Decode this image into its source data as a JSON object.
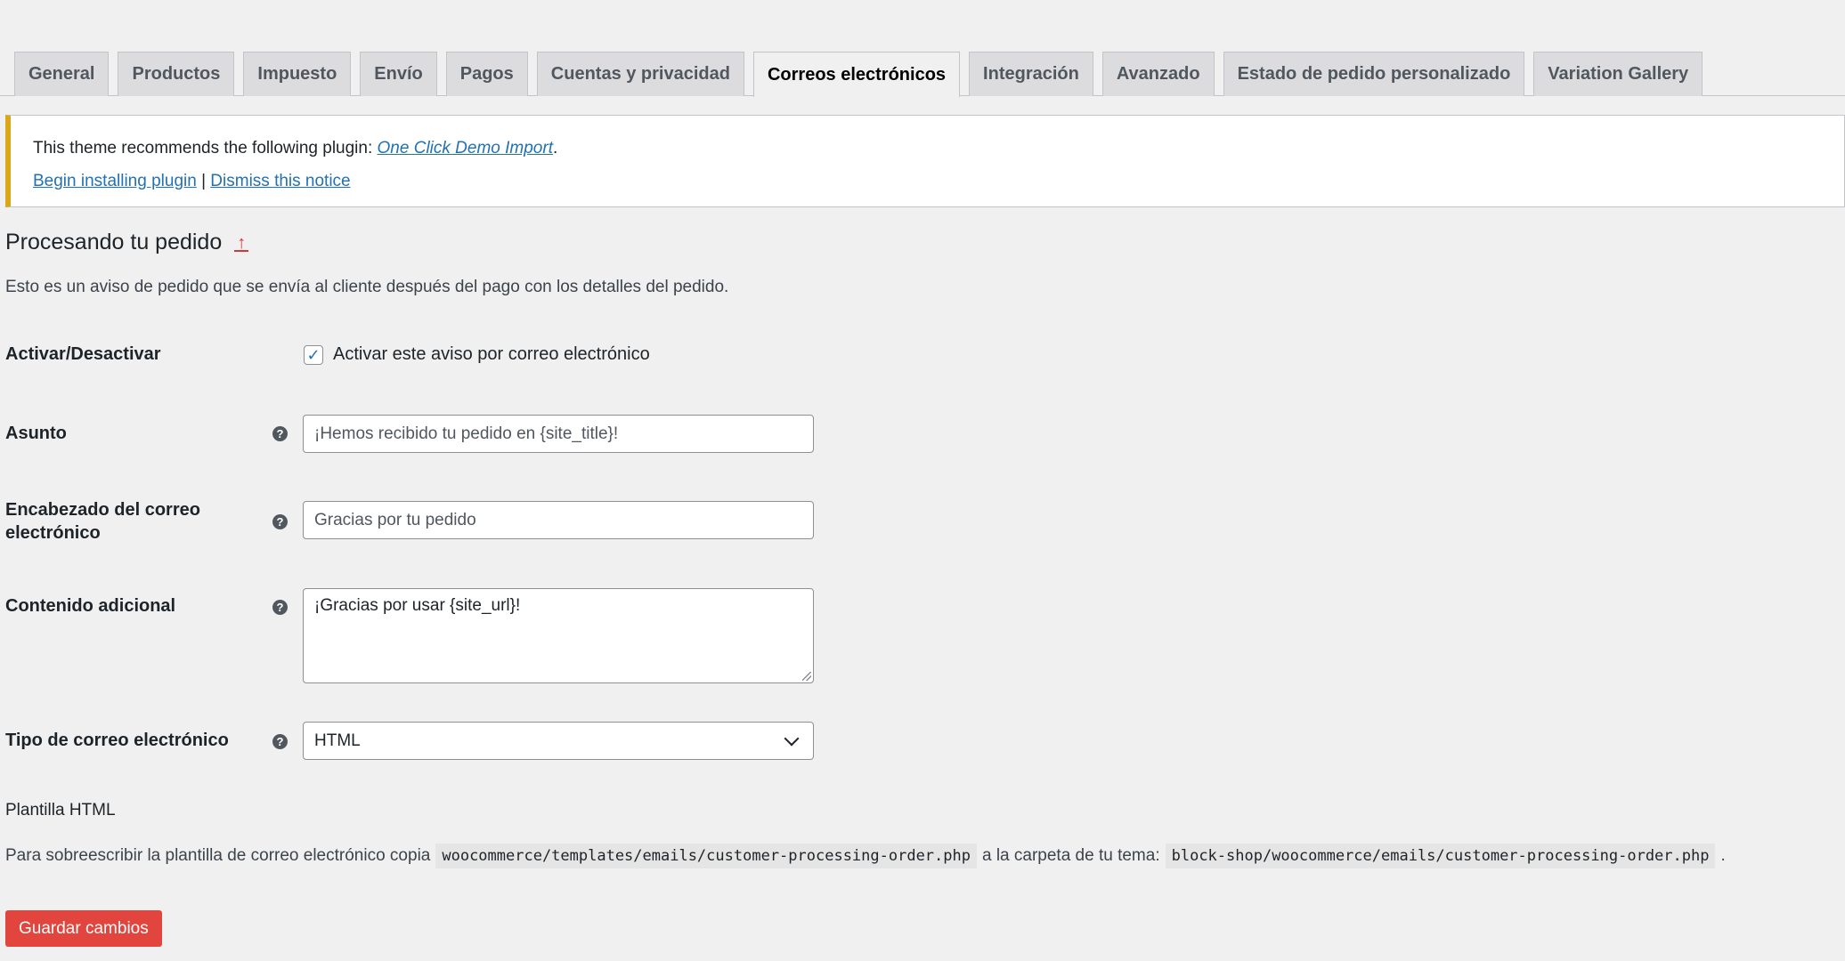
{
  "tabs": [
    {
      "label": "General"
    },
    {
      "label": "Productos"
    },
    {
      "label": "Impuesto"
    },
    {
      "label": "Envío"
    },
    {
      "label": "Pagos"
    },
    {
      "label": "Cuentas y privacidad"
    },
    {
      "label": "Correos electrónicos",
      "active": true
    },
    {
      "label": "Integración"
    },
    {
      "label": "Avanzado"
    },
    {
      "label": "Estado de pedido personalizado"
    },
    {
      "label": "Variation Gallery"
    }
  ],
  "notice": {
    "text_before": "This theme recommends the following plugin: ",
    "plugin_link": "One Click Demo Import",
    "text_after": ".",
    "install_link": "Begin installing plugin",
    "separator": " | ",
    "dismiss_link": "Dismiss this notice",
    "accent_color": "#dba617"
  },
  "section": {
    "title": "Procesando tu pedido",
    "back_icon": "up-arrow-icon",
    "description": "Esto es un aviso de pedido que se envía al cliente después del pago con los detalles del pedido."
  },
  "form": {
    "enable": {
      "label": "Activar/Desactivar",
      "checkbox_label": "Activar este aviso por correo electrónico",
      "checked": true
    },
    "subject": {
      "label": "Asunto",
      "placeholder": "¡Hemos recibido tu pedido en {site_title}!"
    },
    "heading": {
      "label": "Encabezado del correo electrónico",
      "placeholder": "Gracias por tu pedido"
    },
    "additional": {
      "label": "Contenido adicional",
      "value": "¡Gracias por usar {site_url}!"
    },
    "email_type": {
      "label": "Tipo de correo electrónico",
      "selected": "HTML"
    }
  },
  "template": {
    "label": "Plantilla HTML",
    "text_before": "Para sobreescribir la plantilla de correo electrónico copia",
    "source_path": "woocommerce/templates/emails/customer-processing-order.php",
    "text_middle": "a la carpeta de tu tema:",
    "dest_path": "block-shop/woocommerce/emails/customer-processing-order.php",
    "text_after": "."
  },
  "save_button": {
    "label": "Guardar cambios",
    "color": "#e2453d"
  }
}
